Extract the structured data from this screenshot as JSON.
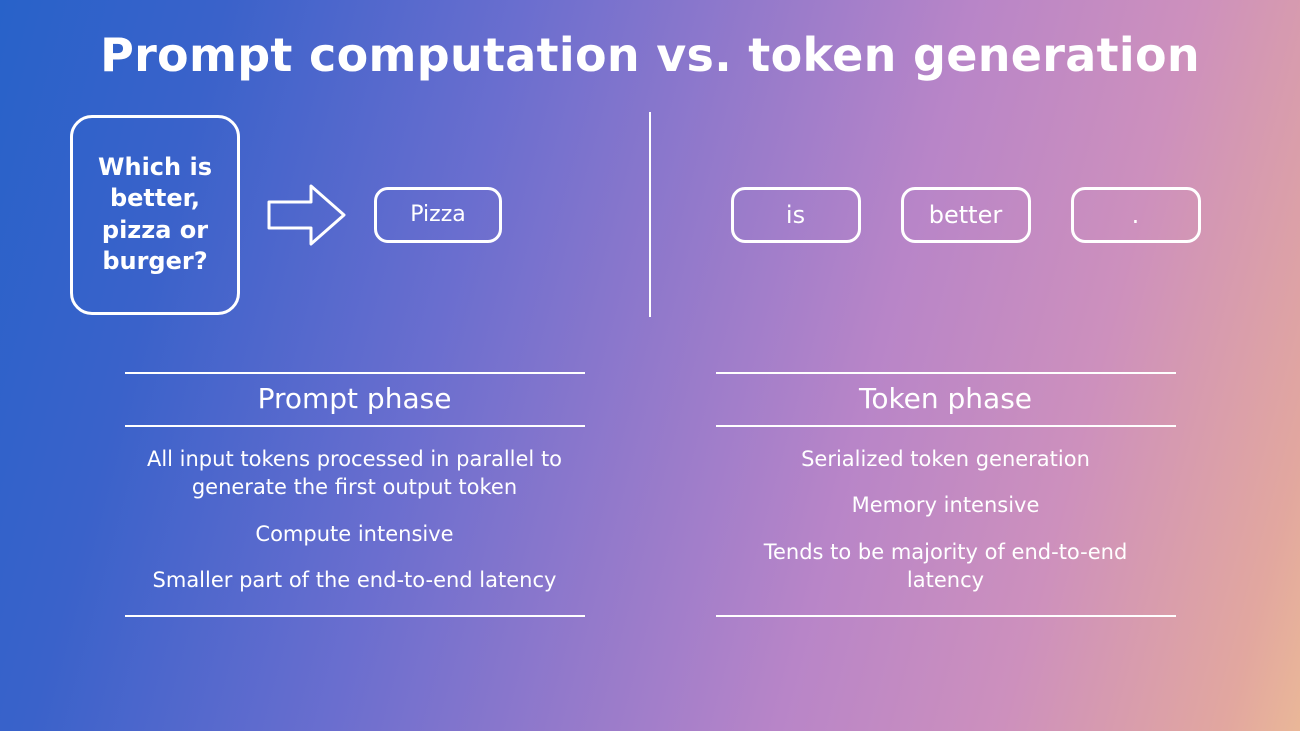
{
  "title": "Prompt computation vs. token generation",
  "left": {
    "prompt_text": "Which is better, pizza or burger?",
    "first_token": "Pizza",
    "panel_title": "Prompt phase",
    "bullets": [
      "All input tokens processed in parallel to generate the first output token",
      "Compute intensive",
      "Smaller part of the end-to-end latency"
    ]
  },
  "right": {
    "tokens": [
      "is",
      "better",
      "."
    ],
    "panel_title": "Token phase",
    "bullets": [
      "Serialized token generation",
      "Memory intensive",
      "Tends to be majority of end-to-end latency"
    ]
  }
}
